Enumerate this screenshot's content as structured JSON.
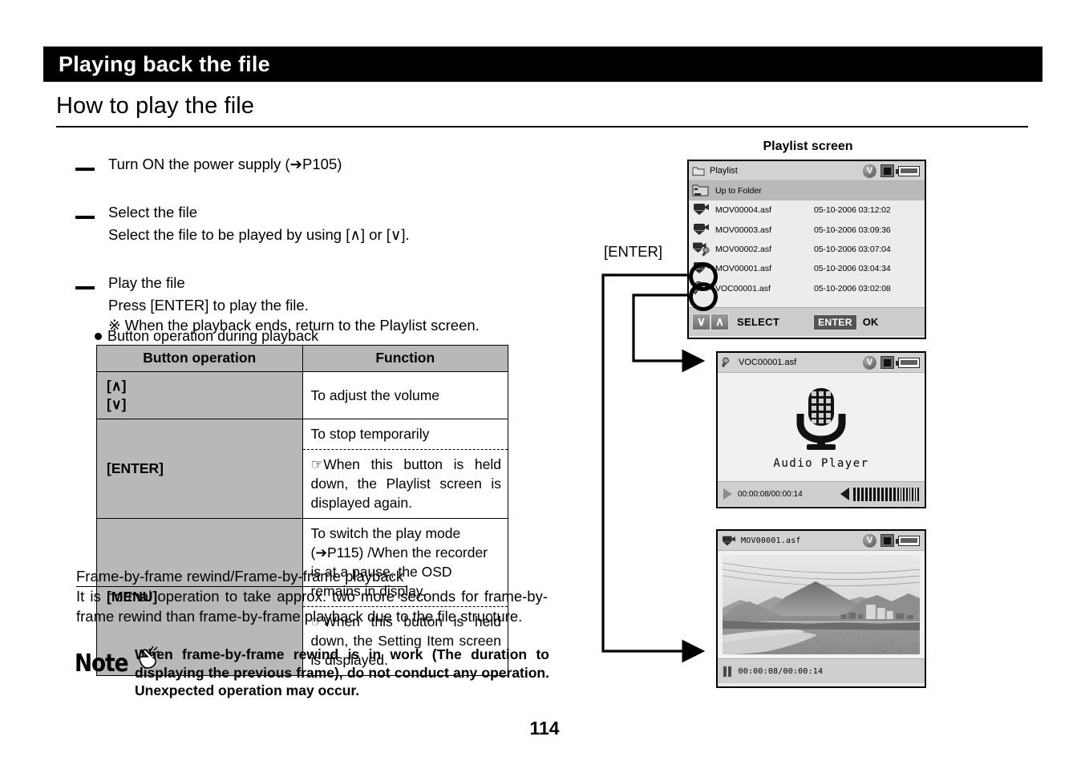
{
  "header": {
    "banner_title": "Playing back the file",
    "section_title": "How to play the file"
  },
  "steps": [
    {
      "mark": "step-dash",
      "lines": [
        "Turn ON the power supply (➔P105)"
      ]
    },
    {
      "mark": "step-dash",
      "lines": [
        "Select the file",
        "Select the file to be played by using [∧] or [∨]."
      ]
    },
    {
      "mark": "step-dash",
      "lines": [
        "Play the file",
        "Press [ENTER] to play the file.",
        "※  When the playback ends, return to the Playlist screen."
      ]
    }
  ],
  "table": {
    "bullet_heading": "Button operation during playback",
    "columns": [
      "Button operation",
      "Function"
    ],
    "rows": [
      {
        "button": "[∧]\n[∨]",
        "button_line1": "[∧]",
        "button_line2": "[∨]",
        "function_single": "To adjust the volume"
      },
      {
        "button_line1": "[ENTER]",
        "function_top": "To stop temporarily",
        "function_bottom": "☞When this button is held down, the Playlist screen is displayed again."
      },
      {
        "button_line1": "[MENU]",
        "function_top": "To switch the play mode (➔P115) /When the recorder is at a pause, the OSD remains in display.",
        "function_bottom": "☞When this button is held down, the Setting Item screen is displayed."
      }
    ]
  },
  "frame_section": {
    "heading": "Frame-by-frame rewind/Frame-by-frame playback",
    "paragraph": "It is normal operation to take approx. two more seconds for frame-by-frame rewind than frame-by-frame playback due to the file structure."
  },
  "note": {
    "badge": "Note",
    "text": "When frame-by-frame rewind is in work (The duration to displaying the previous frame), do not conduct any operation. Unexpected operation may occur."
  },
  "page_number": "114",
  "enter_connector_label": "[ENTER]",
  "playlist_screen": {
    "caption": "Playlist screen",
    "header_title": "Playlist",
    "header_icons": {
      "volume": "V",
      "card": "card-icon",
      "battery": "battery-icon"
    },
    "rows": [
      {
        "icon": "up-folder-icon",
        "name": "Up to Folder",
        "date": "",
        "selected": true
      },
      {
        "icon": "movie-icon",
        "name": "MOV00004.asf",
        "date": "05-10-2006 03:12:02",
        "selected": false
      },
      {
        "icon": "movie-icon",
        "name": "MOV00003.asf",
        "date": "05-10-2006 03:09:36",
        "selected": false
      },
      {
        "icon": "movie-voice-icon",
        "name": "MOV00002.asf",
        "date": "05-10-2006 03:07:04",
        "selected": false
      },
      {
        "icon": "movie-icon",
        "name": "MOV00001.asf",
        "date": "05-10-2006 03:04:34",
        "selected": false
      },
      {
        "icon": "voice-icon",
        "name": "VOC00001.asf",
        "date": "05-10-2006 03:02:08",
        "selected": false
      }
    ],
    "footer": {
      "key_down": "∨",
      "key_up": "∧",
      "select_label": "SELECT",
      "enter_key": "ENTER",
      "ok_label": "OK"
    }
  },
  "audio_screen": {
    "header_title": "VOC00001.asf",
    "header_icons": {
      "volume": "V",
      "card": "card-icon",
      "battery": "battery-icon"
    },
    "body_label": "Audio Player",
    "body_icon": "microphone-icon",
    "footer": {
      "state_icon": "play-icon",
      "time": "00:00:08/00:00:14",
      "speaker_icon": "speaker-icon",
      "volume_filled": 11,
      "volume_total": 20
    }
  },
  "video_screen": {
    "header_title": "MOV00001.asf",
    "header_icons": {
      "volume": "V",
      "card": "card-icon",
      "battery": "battery-icon"
    },
    "body_icon": "landscape-thumbnail",
    "footer": {
      "state_icon": "pause-icon",
      "time": "00:00:08/00:00:14"
    }
  }
}
